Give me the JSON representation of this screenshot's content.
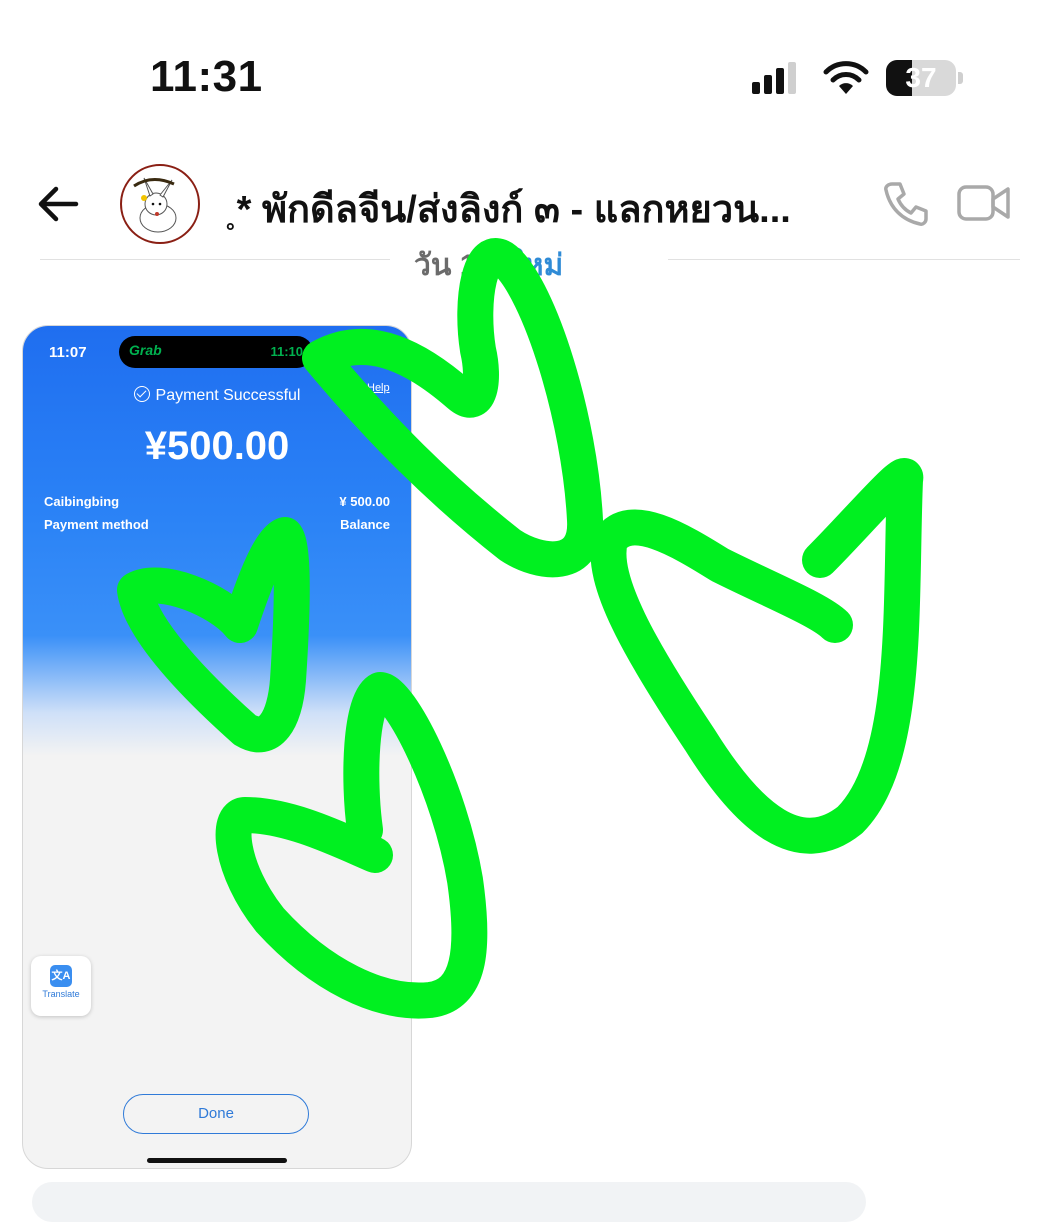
{
  "status_bar": {
    "time": "11:31",
    "battery": "37",
    "battery_level": 0.37
  },
  "chat": {
    "title": "˳* พักดีลจีน/ส่งลิงก์ ๓ - แลกหยวน...",
    "date_partial": "วัน 17",
    "new_label": "ใหม่"
  },
  "icons": {
    "back": "arrow-left-icon",
    "call": "phone-icon",
    "video": "video-camera-icon",
    "signal": "cellular-signal-icon",
    "wifi": "wifi-icon",
    "battery": "battery-icon"
  },
  "shared_image": {
    "time": "11:07",
    "island_app": "Grab",
    "island_time": "11:10",
    "help_text": "Help",
    "status": "Payment Successful",
    "amount": "¥500.00",
    "rows": [
      {
        "label": "Caibingbing",
        "value": "¥ 500.00"
      },
      {
        "label": "Payment method",
        "value": "Balance"
      }
    ],
    "translate_label": "Translate",
    "done_label": "Done"
  },
  "colors": {
    "scribble": "#00f020",
    "accent_blue": "#2f8bd6",
    "payment_blue": "#1f6ef0"
  }
}
